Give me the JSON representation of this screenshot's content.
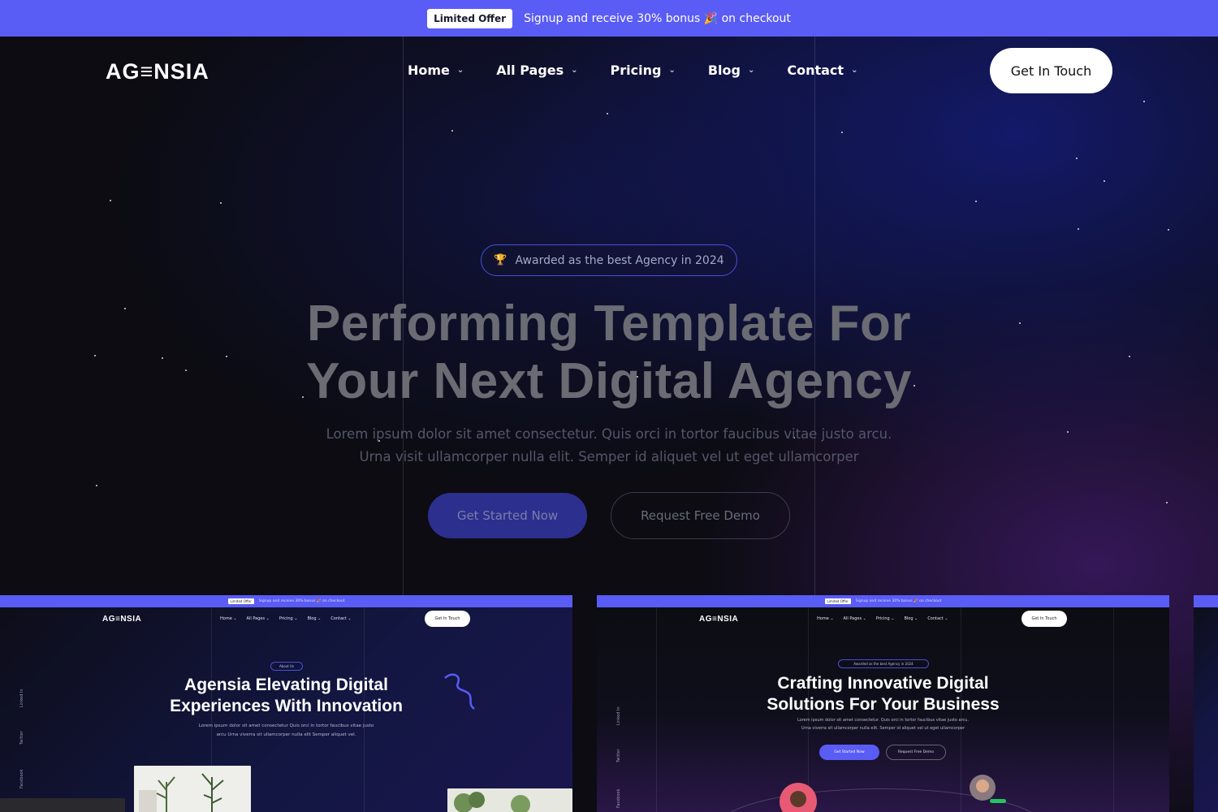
{
  "topbar": {
    "badge": "Limited Offer",
    "text": "Signup and receive 30% bonus 🎉 on checkout"
  },
  "header": {
    "logo": "AG≡NSIA",
    "nav": [
      {
        "label": "Home",
        "icon": "chevron-down-icon"
      },
      {
        "label": "All Pages",
        "icon": "chevron-down-icon"
      },
      {
        "label": "Pricing",
        "icon": "chevron-down-icon"
      },
      {
        "label": "Blog",
        "icon": "chevron-down-icon"
      },
      {
        "label": "Contact",
        "icon": "chevron-down-icon"
      }
    ],
    "cta": "Get In Touch"
  },
  "hero": {
    "award_icon": "trophy-icon",
    "award": "Awarded as the best Agency in 2024",
    "title_line1": "Performing Template For",
    "title_line2": "Your Next Digital Agency",
    "desc_line1": "Lorem ipsum dolor sit amet consectetur. Quis orci in tortor faucibus vitae justo arcu.",
    "desc_line2": "Urna visit ullamcorper nulla elit. Semper id aliquet vel ut eget ullamcorper",
    "primary_button": "Get Started Now",
    "secondary_button": "Request Free Demo"
  },
  "previews": [
    {
      "topbar_badge": "Limited Offer",
      "topbar_text": "Signup and receive 30% bonus 🎉 on checkout",
      "logo": "AG≡NSIA",
      "nav": [
        "Home ⌄",
        "All Pages ⌄",
        "Pricing ⌄",
        "Blog ⌄",
        "Contact ⌄"
      ],
      "cta": "Get In Touch",
      "social": [
        "Linked In",
        "Twitter",
        "Facebook"
      ],
      "pill": "About Us",
      "title_line1": "Agensia Elevating Digital",
      "title_line2": "Experiences With Innovation",
      "desc_line1": "Lorem ipsum dolor sit amet consectetur Quis orci in tortor faucibus vitae justo",
      "desc_line2": "arcu Urna viverra sit ullamcorper nulla elit Semper aliquet vel."
    },
    {
      "topbar_badge": "Limited Offer",
      "topbar_text": "Signup and receive 30% bonus 🎉 on checkout",
      "logo": "AG≡NSIA",
      "nav": [
        "Home ⌄",
        "All Pages ⌄",
        "Pricing ⌄",
        "Blog ⌄",
        "Contact ⌄"
      ],
      "cta": "Get In Touch",
      "social": [
        "Linked In",
        "Twitter",
        "Facebook"
      ],
      "pill": "Awarded as the best Agency in 2024",
      "title_line1": "Crafting Innovative Digital",
      "title_line2": "Solutions For Your Business",
      "desc_line1": "Lorem ipsum dolor sit amet consectetur. Quis orci in tortor faucibus vitae justo arcu.",
      "desc_line2": "Urna viverra sit ullamcorper nulla elit. Semper id aliquet vel ut eget ullamcorper",
      "btn1": "Get Started Now",
      "btn2": "Request Free Demo"
    }
  ],
  "colors": {
    "accent": "#5a5cf6",
    "background": "#0c0c12"
  }
}
